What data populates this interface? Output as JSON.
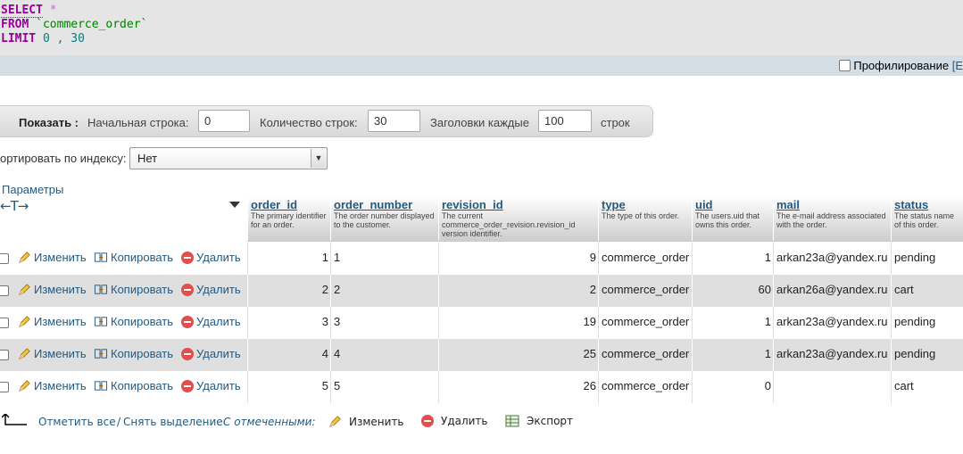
{
  "sql": {
    "select_kw": "SELECT",
    "star": "*",
    "from_kw": "FROM",
    "table": "`commerce_order`",
    "limit_kw": "LIMIT",
    "limit_start": "0",
    "limit_comma": ",",
    "limit_count": "30"
  },
  "profiling": {
    "label": "Профилирование",
    "edit_fragment": "[E"
  },
  "navigation": {
    "show_label": "Показать :",
    "start_row_label": "Начальная строка:",
    "start_row_value": "0",
    "row_count_label": "Количество строк:",
    "row_count_value": "30",
    "headers_every_label": "Заголовки каждые",
    "headers_every_value": "100",
    "rows_suffix": "строк"
  },
  "sort_by_index": {
    "label": "ортировать по индексу:",
    "selected": "Нет"
  },
  "table": {
    "options_link": "Параметры",
    "arrows_glyph": "←T→",
    "actions": {
      "edit": "Изменить",
      "copy": "Копировать",
      "delete": "Удалить"
    },
    "columns": [
      {
        "name": "order_id",
        "comment": "The primary identifier for an order."
      },
      {
        "name": "order_number",
        "comment": "The order number displayed to the customer."
      },
      {
        "name": "revision_id",
        "comment": "The current commerce_order_revision.revision_id version identifier."
      },
      {
        "name": "type",
        "comment": "The type of this order."
      },
      {
        "name": "uid",
        "comment": "The users.uid that owns this order."
      },
      {
        "name": "mail",
        "comment": "The e-mail address associated with the order."
      },
      {
        "name": "status",
        "comment": "The status name of this order."
      }
    ],
    "rows": [
      {
        "order_id": "1",
        "order_number": "1",
        "revision_id": "9",
        "type": "commerce_order",
        "uid": "1",
        "mail": "arkan23a@yandex.ru",
        "status": "pending"
      },
      {
        "order_id": "2",
        "order_number": "2",
        "revision_id": "2",
        "type": "commerce_order",
        "uid": "60",
        "mail": "arkan26a@yandex.ru",
        "status": "cart"
      },
      {
        "order_id": "3",
        "order_number": "3",
        "revision_id": "19",
        "type": "commerce_order",
        "uid": "1",
        "mail": "arkan23a@yandex.ru",
        "status": "pending"
      },
      {
        "order_id": "4",
        "order_number": "4",
        "revision_id": "25",
        "type": "commerce_order",
        "uid": "1",
        "mail": "arkan23a@yandex.ru",
        "status": "pending"
      },
      {
        "order_id": "5",
        "order_number": "5",
        "revision_id": "26",
        "type": "commerce_order",
        "uid": "0",
        "mail": "",
        "status": "cart"
      }
    ]
  },
  "footer": {
    "select_all": "Отметить все",
    "separator": "/",
    "deselect": "Снять выделение",
    "with_selected": "С отмеченными:",
    "edit": "Изменить",
    "delete": "Удалить",
    "export": "Экспорт"
  },
  "colors": {
    "link": "#235a81",
    "sql_keyword": "#990099",
    "row_alt": "#dfdfdf",
    "delete_icon": "#e04e4e"
  }
}
